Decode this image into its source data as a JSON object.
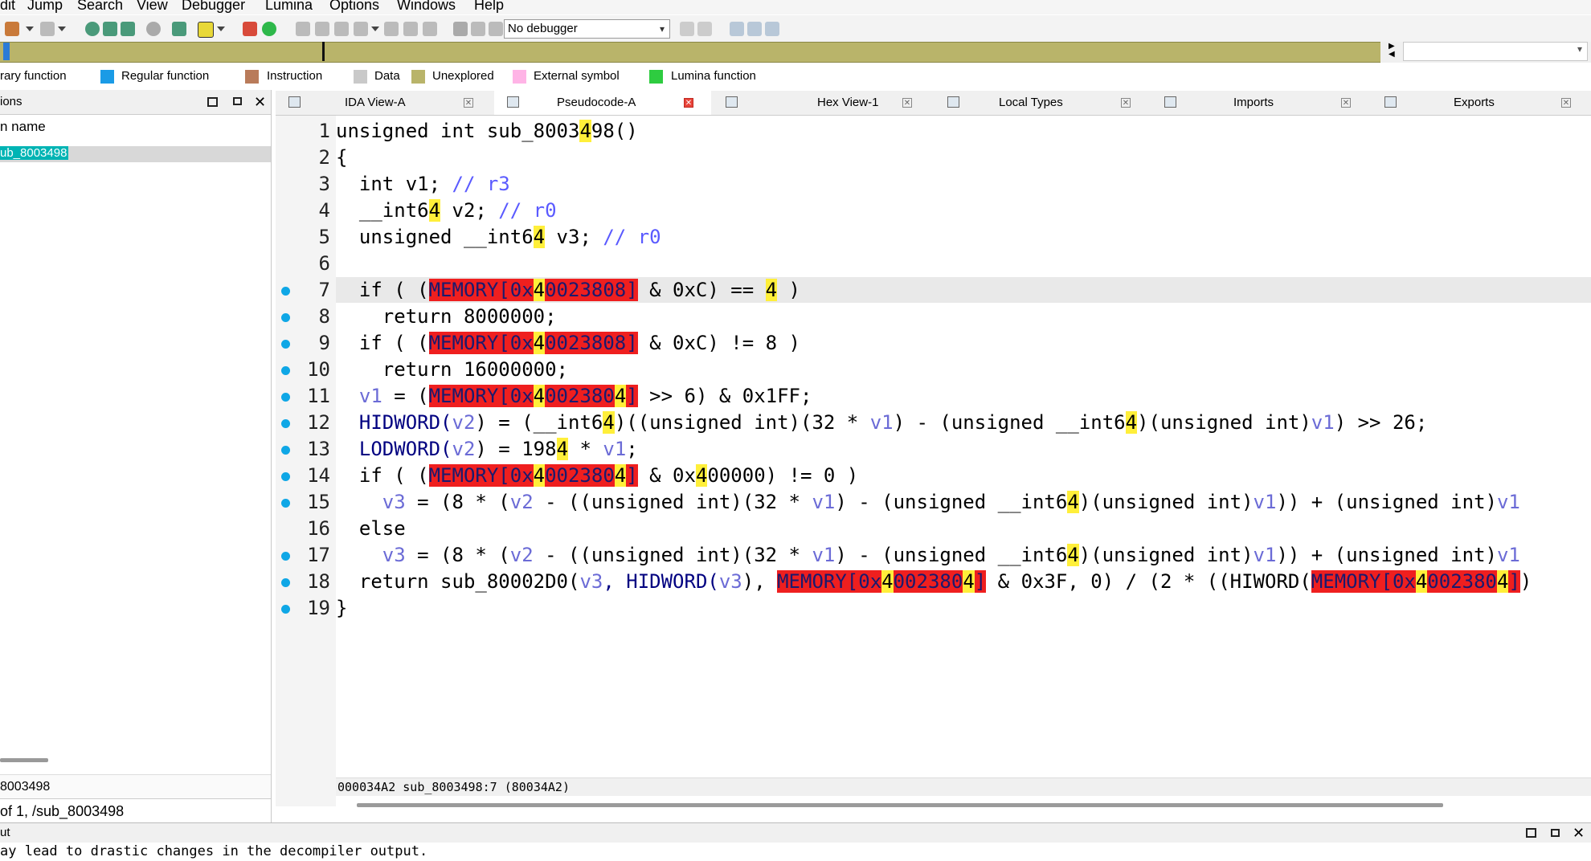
{
  "menu": [
    "dit",
    "Jump",
    "Search",
    "View",
    "Debugger",
    "Lumina",
    "Options",
    "Windows",
    "Help"
  ],
  "toolbar": {
    "debugger_select": "No debugger"
  },
  "legend": [
    {
      "label": "rary function",
      "color": "#00bcd4"
    },
    {
      "label": "Regular function",
      "color": "#1a9be6"
    },
    {
      "label": "Instruction",
      "color": "#b97b5a"
    },
    {
      "label": "Data",
      "color": "#c9c9c9"
    },
    {
      "label": "Unexplored",
      "color": "#b9b46a"
    },
    {
      "label": "External symbol",
      "color": "#ffb4e6"
    },
    {
      "label": "Lumina function",
      "color": "#2ecc40"
    }
  ],
  "left_panel": {
    "title": "ions",
    "column_header": "n name",
    "selected_row": "ub_8003498",
    "address": "8003498",
    "path": "of 1, /sub_8003498"
  },
  "tabs": [
    {
      "label": "IDA View-A",
      "icon": "graph-icon",
      "active": false
    },
    {
      "label": "Pseudocode-A",
      "icon": "pseudocode-icon",
      "active": true
    },
    {
      "label": "Hex View-1",
      "icon": "hex-icon",
      "active": false
    },
    {
      "label": "Local Types",
      "icon": "types-icon",
      "active": false
    },
    {
      "label": "Imports",
      "icon": "imports-icon",
      "active": false
    },
    {
      "label": "Exports",
      "icon": "exports-icon",
      "active": false
    }
  ],
  "code": {
    "highlighted_line": 7,
    "lines": [
      {
        "n": "1",
        "bp": false,
        "segs": [
          [
            "unsigned int sub_8003",
            "t"
          ],
          [
            "4",
            "y"
          ],
          [
            "98()",
            "t"
          ]
        ]
      },
      {
        "n": "2",
        "bp": false,
        "segs": [
          [
            "{",
            "t"
          ]
        ]
      },
      {
        "n": "3",
        "bp": false,
        "segs": [
          [
            "  int v1; ",
            "t"
          ],
          [
            "// r3",
            "c"
          ]
        ]
      },
      {
        "n": "4",
        "bp": false,
        "segs": [
          [
            "  __int6",
            "t"
          ],
          [
            "4",
            "y"
          ],
          [
            " v2; ",
            "t"
          ],
          [
            "// r0",
            "c"
          ]
        ]
      },
      {
        "n": "5",
        "bp": false,
        "segs": [
          [
            "  unsigned __int6",
            "t"
          ],
          [
            "4",
            "y"
          ],
          [
            " v3; ",
            "t"
          ],
          [
            "// r0",
            "c"
          ]
        ]
      },
      {
        "n": "6",
        "bp": false,
        "segs": []
      },
      {
        "n": "7",
        "bp": true,
        "segs": [
          [
            "  if ( (",
            "t"
          ],
          [
            "MEMORY[0x",
            "m"
          ],
          [
            "4",
            "my"
          ],
          [
            "0023808]",
            "m"
          ],
          [
            " & 0xC) == ",
            "t"
          ],
          [
            "4",
            "y"
          ],
          [
            " )",
            "t"
          ]
        ]
      },
      {
        "n": "8",
        "bp": true,
        "segs": [
          [
            "    return 8000000;",
            "t"
          ]
        ]
      },
      {
        "n": "9",
        "bp": true,
        "segs": [
          [
            "  if ( (",
            "t"
          ],
          [
            "MEMORY[0x",
            "m"
          ],
          [
            "4",
            "my"
          ],
          [
            "0023808]",
            "m"
          ],
          [
            " & 0xC) != 8 )",
            "t"
          ]
        ]
      },
      {
        "n": "10",
        "bp": true,
        "segs": [
          [
            "    return 16000000;",
            "t"
          ]
        ]
      },
      {
        "n": "11",
        "bp": true,
        "segs": [
          [
            "  ",
            "t"
          ],
          [
            "v1",
            "v"
          ],
          [
            " = (",
            "t"
          ],
          [
            "MEMORY[0x",
            "m"
          ],
          [
            "4",
            "my"
          ],
          [
            "002380",
            "m"
          ],
          [
            "4",
            "my"
          ],
          [
            "]",
            "m"
          ],
          [
            " >> 6) & 0x1FF;",
            "t"
          ]
        ]
      },
      {
        "n": "12",
        "bp": true,
        "segs": [
          [
            "  HIDWORD(",
            "k"
          ],
          [
            "v2",
            "v"
          ],
          [
            ") = (__int6",
            "t"
          ],
          [
            "4",
            "y"
          ],
          [
            ")((unsigned int)(32 * ",
            "t"
          ],
          [
            "v1",
            "v"
          ],
          [
            ") - (unsigned __int6",
            "t"
          ],
          [
            "4",
            "y"
          ],
          [
            ")(unsigned int)",
            "t"
          ],
          [
            "v1",
            "v"
          ],
          [
            ") >> 26;",
            "t"
          ]
        ]
      },
      {
        "n": "13",
        "bp": true,
        "segs": [
          [
            "  LODWORD(",
            "k"
          ],
          [
            "v2",
            "v"
          ],
          [
            ") = 198",
            "t"
          ],
          [
            "4",
            "y"
          ],
          [
            " * ",
            "t"
          ],
          [
            "v1",
            "v"
          ],
          [
            ";",
            "t"
          ]
        ]
      },
      {
        "n": "14",
        "bp": true,
        "segs": [
          [
            "  if ( (",
            "t"
          ],
          [
            "MEMORY[0x",
            "m"
          ],
          [
            "4",
            "my"
          ],
          [
            "002380",
            "m"
          ],
          [
            "4",
            "my"
          ],
          [
            "]",
            "m"
          ],
          [
            " & 0x",
            "t"
          ],
          [
            "4",
            "y"
          ],
          [
            "00000) != 0 )",
            "t"
          ]
        ]
      },
      {
        "n": "15",
        "bp": true,
        "segs": [
          [
            "    ",
            "t"
          ],
          [
            "v3",
            "v"
          ],
          [
            " = (8 * (",
            "t"
          ],
          [
            "v2",
            "v"
          ],
          [
            " - ((unsigned int)(32 * ",
            "t"
          ],
          [
            "v1",
            "v"
          ],
          [
            ") - (unsigned __int6",
            "t"
          ],
          [
            "4",
            "y"
          ],
          [
            ")(unsigned int)",
            "t"
          ],
          [
            "v1",
            "v"
          ],
          [
            ")) + (unsigned int)",
            "t"
          ],
          [
            "v1",
            "v"
          ]
        ]
      },
      {
        "n": "16",
        "bp": false,
        "segs": [
          [
            "  else",
            "t"
          ]
        ]
      },
      {
        "n": "17",
        "bp": true,
        "segs": [
          [
            "    ",
            "t"
          ],
          [
            "v3",
            "v"
          ],
          [
            " = (8 * (",
            "t"
          ],
          [
            "v2",
            "v"
          ],
          [
            " - ((unsigned int)(32 * ",
            "t"
          ],
          [
            "v1",
            "v"
          ],
          [
            ") - (unsigned __int6",
            "t"
          ],
          [
            "4",
            "y"
          ],
          [
            ")(unsigned int)",
            "t"
          ],
          [
            "v1",
            "v"
          ],
          [
            ")) + (unsigned int)",
            "t"
          ],
          [
            "v1",
            "v"
          ]
        ]
      },
      {
        "n": "18",
        "bp": true,
        "segs": [
          [
            "  return sub_80002D0(",
            "t"
          ],
          [
            "v3",
            "v"
          ],
          [
            ", HIDWORD(",
            "k"
          ],
          [
            "v3",
            "v"
          ],
          [
            "), ",
            "t"
          ],
          [
            "MEMORY[0x",
            "m"
          ],
          [
            "4",
            "my"
          ],
          [
            "002380",
            "m"
          ],
          [
            "4",
            "my"
          ],
          [
            "]",
            "m"
          ],
          [
            " & 0x3F, 0) / (2 * ((HIWORD(",
            "t"
          ],
          [
            "MEMORY[0x",
            "m"
          ],
          [
            "4",
            "my"
          ],
          [
            "002380",
            "m"
          ],
          [
            "4",
            "my"
          ],
          [
            "]",
            "m"
          ],
          [
            ")",
            "t"
          ]
        ]
      },
      {
        "n": "19",
        "bp": true,
        "segs": [
          [
            "}",
            "t"
          ]
        ]
      }
    ]
  },
  "status": "000034A2 sub_8003498:7 (80034A2)",
  "output": {
    "title": "ut",
    "text": "ay lead to drastic changes in the decompiler output."
  }
}
